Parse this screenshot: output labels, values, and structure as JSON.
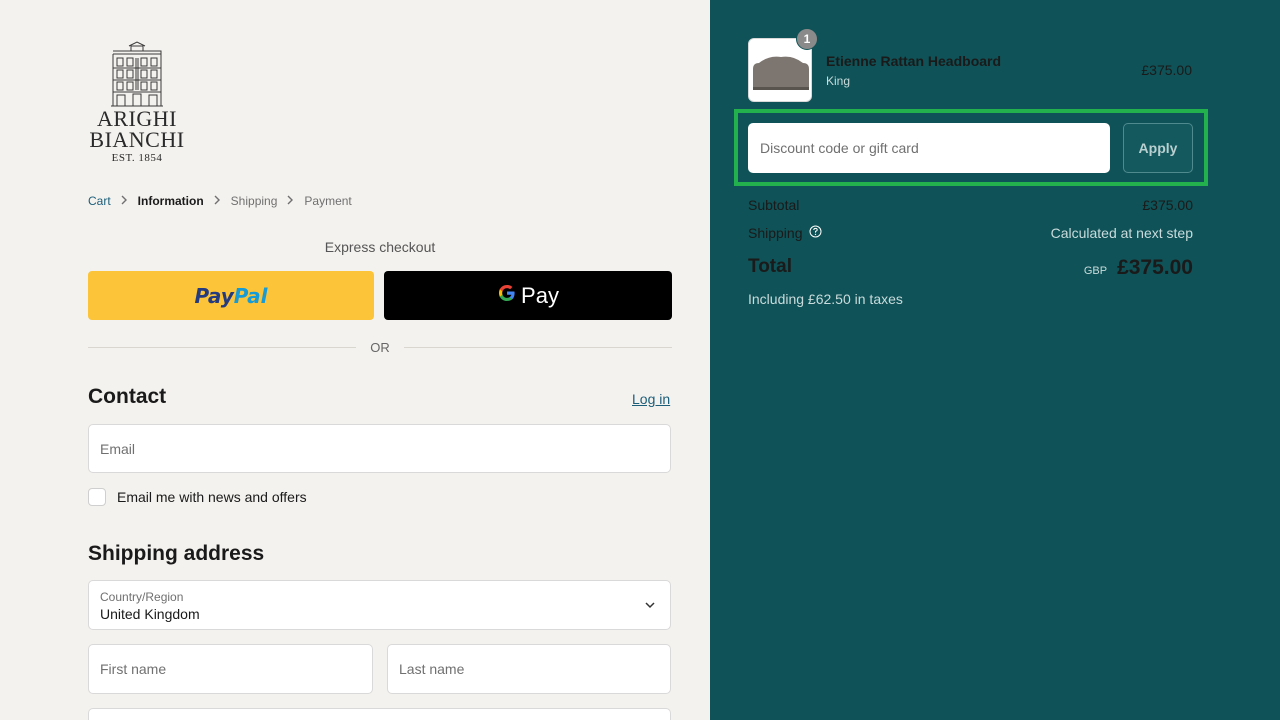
{
  "brand": {
    "line1": "ARIGHI",
    "line2": "BIANCHI",
    "line3": "EST. 1854"
  },
  "breadcrumb": [
    {
      "label": "Cart"
    },
    {
      "label": "Information"
    },
    {
      "label": "Shipping"
    },
    {
      "label": "Payment"
    }
  ],
  "express": {
    "label": "Express checkout",
    "paypal_part1": "Pay",
    "paypal_part2": "Pal",
    "gpay_label": "Pay",
    "or_label": "OR"
  },
  "contact": {
    "title": "Contact",
    "login_label": "Log in",
    "email_placeholder": "Email",
    "newsletter_label": "Email me with news and offers"
  },
  "shipping_address": {
    "title": "Shipping address",
    "country_label": "Country/Region",
    "country_value": "United Kingdom",
    "first_name_placeholder": "First name",
    "last_name_placeholder": "Last name"
  },
  "order": {
    "item": {
      "quantity": "1",
      "name": "Etienne Rattan Headboard",
      "variant": "King",
      "price": "£375.00"
    },
    "discount_placeholder": "Discount code or gift card",
    "apply_label": "Apply",
    "subtotal_label": "Subtotal",
    "subtotal_value": "£375.00",
    "shipping_label": "Shipping",
    "shipping_value": "Calculated at next step",
    "total_label": "Total",
    "currency": "GBP",
    "total_value": "£375.00",
    "tax_note": "Including £62.50 in taxes"
  },
  "colors": {
    "sidebar_bg": "#0f5257",
    "page_bg": "#f4f2ee",
    "paypal_yellow": "#fcc439",
    "highlight_green": "#22b14c"
  }
}
